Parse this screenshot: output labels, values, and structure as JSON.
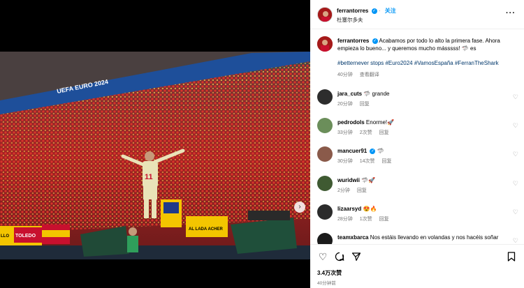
{
  "header": {
    "username": "ferrantorres",
    "follow_label": "关注",
    "location": "杜塞尔多夫",
    "more_icon": "more-options-icon"
  },
  "photo": {
    "banner_text": "UEFA EURO 2024",
    "flag_text_1": "TOLEDO",
    "flag_text_2": "AL LADA ACHER",
    "flag_text_3": "LLO"
  },
  "caption": {
    "username": "ferrantorres",
    "text": "Acabamos por todo lo alto la primera fase. Ahora empieza lo bueno... y queremos mucho másssss! 🦈 es",
    "hashtags": "#betternever stops #Euro2024 #VamosEspaña #FerranTheShark",
    "time": "40分钟",
    "translate": "查看翻译"
  },
  "comments": [
    {
      "username": "jara_cuts",
      "verified": false,
      "text": "🦈 grande",
      "time": "20分钟",
      "likes": "",
      "reply": "回复"
    },
    {
      "username": "pedrodols",
      "verified": false,
      "text": "Enorme!🚀",
      "time": "33分钟",
      "likes": "2次赞",
      "reply": "回复"
    },
    {
      "username": "mancuer91",
      "verified": true,
      "text": "🦈",
      "time": "30分钟",
      "likes": "14次赞",
      "reply": "回复"
    },
    {
      "username": "wuridwii",
      "verified": false,
      "text": "🦈🚀",
      "time": "2分钟",
      "likes": "",
      "reply": "回复"
    },
    {
      "username": "lizaarsyd",
      "verified": false,
      "text": "😍🔥",
      "time": "28分钟",
      "likes": "1次赞",
      "reply": "回复"
    },
    {
      "username": "teamxbarca",
      "verified": false,
      "text": "Nos estáis llevando en volandas y nos hacéis soñar",
      "time": "",
      "likes": "",
      "reply": ""
    }
  ],
  "actions": {
    "likes": "3.4万次赞",
    "post_time": "40分钟前"
  },
  "colors": {
    "link_blue": "#0095f6",
    "hashtag_blue": "#00376b",
    "meta_gray": "#737373"
  }
}
